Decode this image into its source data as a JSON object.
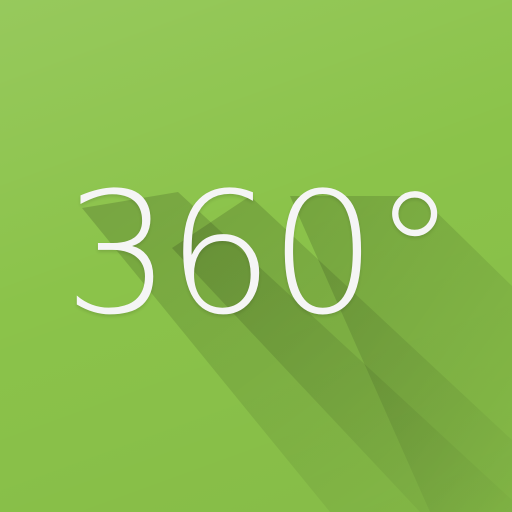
{
  "icon": {
    "label": "360°",
    "background_color": "#8bc34a",
    "label_color": "#f5f5f5",
    "shadow_color": "#6d9c3a"
  }
}
